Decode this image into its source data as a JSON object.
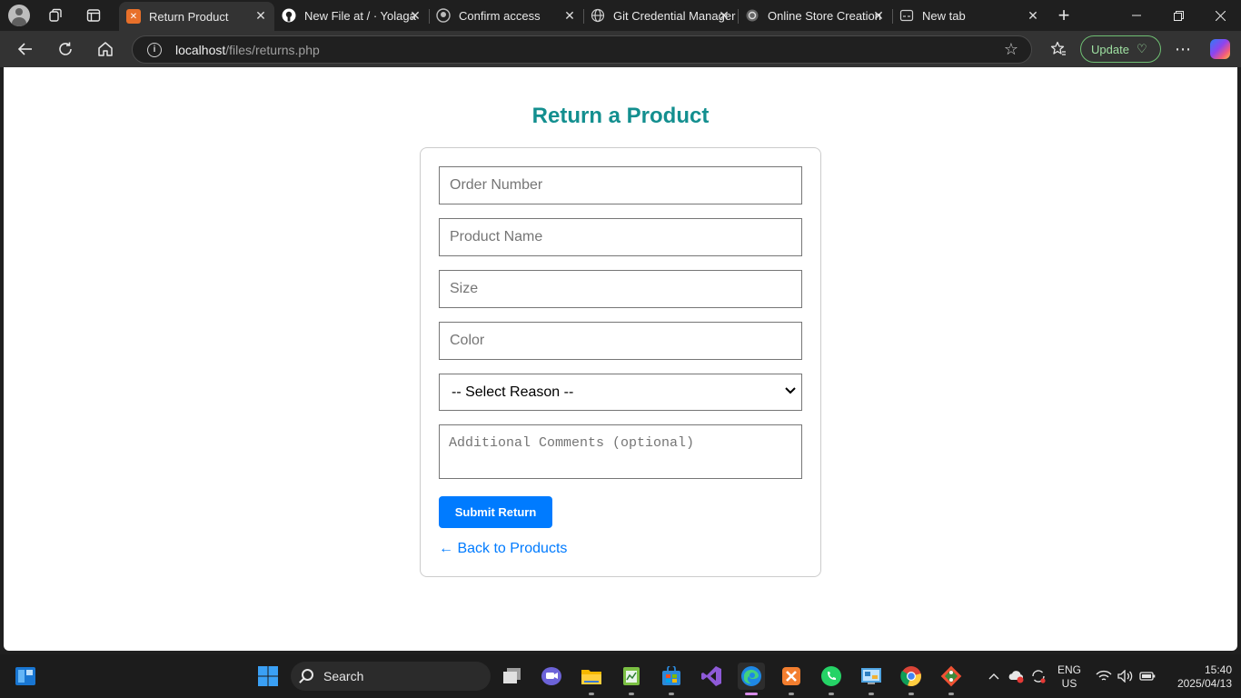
{
  "browser": {
    "tabs": [
      {
        "title": "Return Product",
        "active": true,
        "favicon": "xampp-icon",
        "favicon_color": "#e8702a"
      },
      {
        "title": "New File at / · Yolaga",
        "active": false,
        "favicon": "github-icon",
        "favicon_color": "#ffffff"
      },
      {
        "title": "Confirm access",
        "active": false,
        "favicon": "github-icon",
        "favicon_color": "#ffffff"
      },
      {
        "title": "Git Credential Manager",
        "active": false,
        "favicon": "globe-icon",
        "favicon_color": "#cccccc"
      },
      {
        "title": "Online Store Creation",
        "active": false,
        "favicon": "chatgpt-icon",
        "favicon_color": "#cccccc"
      },
      {
        "title": "New tab",
        "active": false,
        "favicon": "newtab-icon",
        "favicon_color": "#cccccc"
      }
    ],
    "address": {
      "host": "localhost",
      "path": "/files/returns.php"
    },
    "update_label": "Update"
  },
  "page": {
    "title": "Return a Product",
    "title_color": "#138f8f",
    "form": {
      "order_number_placeholder": "Order Number",
      "product_name_placeholder": "Product Name",
      "size_placeholder": "Size",
      "color_placeholder": "Color",
      "reason_selected": "-- Select Reason --",
      "comments_placeholder": "Additional Comments (optional)",
      "submit_label": "Submit Return",
      "back_link": "← Back to Products"
    },
    "accent_color": "#007bff"
  },
  "taskbar": {
    "search_label": "Search",
    "apps": [
      "start-icon",
      "search",
      "task-view-icon",
      "meet-icon",
      "file-explorer-icon",
      "notepad-icon",
      "store-icon",
      "visual-studio-icon",
      "edge-icon",
      "xampp-icon",
      "whatsapp-icon",
      "control-panel-icon",
      "chrome-icon",
      "git-icon"
    ],
    "language": {
      "line1": "ENG",
      "line2": "US"
    },
    "clock": {
      "time": "15:40",
      "date": "2025/04/13"
    }
  }
}
